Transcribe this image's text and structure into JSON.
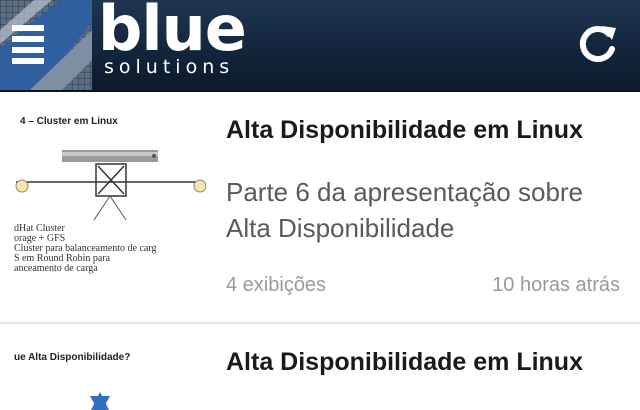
{
  "header": {
    "brand_main": "blue",
    "brand_sub": "solutions",
    "menu_icon": "hamburger-menu-icon",
    "refresh_icon": "refresh-icon",
    "colors": {
      "bar": "#13263d",
      "text": "#ffffff"
    }
  },
  "feed": {
    "items": [
      {
        "thumbnail_title": "4 – Cluster em Linux",
        "thumbnail_text": "dHat Cluster\norage + GFS\nCluster para balanceamento de carg\nS em Round Robin para\nanceamento de carga",
        "title": "Alta Disponibilidade em Linux",
        "description": "Parte 6 da apresentação sobre Alta Disponibilidade",
        "views": "4 exibições",
        "time": "10 horas atrás"
      },
      {
        "thumbnail_title": "ue Alta Disponibilidade?",
        "title": "Alta Disponibilidade em Linux"
      }
    ]
  }
}
